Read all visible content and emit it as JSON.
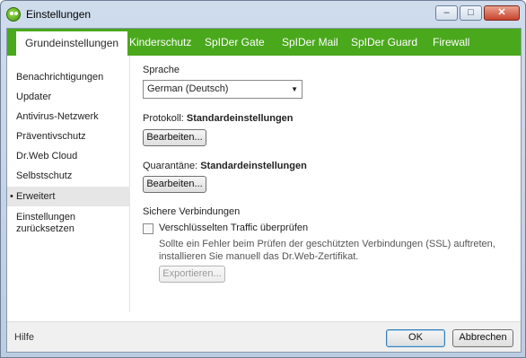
{
  "window": {
    "title": "Einstellungen"
  },
  "tabs": [
    {
      "label": "Grundeinstellungen"
    },
    {
      "label": "Kinderschutz"
    },
    {
      "label": "SpIDer Gate"
    },
    {
      "label": "SpIDer Mail"
    },
    {
      "label": "SpIDer Guard"
    },
    {
      "label": "Firewall"
    }
  ],
  "sidebar": {
    "items": [
      {
        "label": "Benachrichtigungen"
      },
      {
        "label": "Updater"
      },
      {
        "label": "Antivirus-Netzwerk"
      },
      {
        "label": "Präventivschutz"
      },
      {
        "label": "Dr.Web Cloud"
      },
      {
        "label": "Selbstschutz"
      },
      {
        "label": "Erweitert"
      },
      {
        "label": "Einstellungen zurücksetzen"
      }
    ],
    "active_bullet": "•"
  },
  "main": {
    "language_label": "Sprache",
    "language_value": "German (Deutsch)",
    "protocol_label": "Protokoll:",
    "protocol_value": "Standardeinstellungen",
    "protocol_edit": "Bearbeiten...",
    "quarantine_label": "Quarantäne:",
    "quarantine_value": "Standardeinstellungen",
    "quarantine_edit": "Bearbeiten...",
    "secure_label": "Sichere Verbindungen",
    "check_encrypted_label": "Verschlüsselten Traffic überprüfen",
    "ssl_description": "Sollte ein Fehler beim Prüfen der geschützten Verbindungen (SSL) auftreten, installieren Sie manuell das Dr.Web-Zertifikat.",
    "export_button": "Exportieren..."
  },
  "footer": {
    "help": "Hilfe",
    "ok": "OK",
    "cancel": "Abbrechen"
  }
}
